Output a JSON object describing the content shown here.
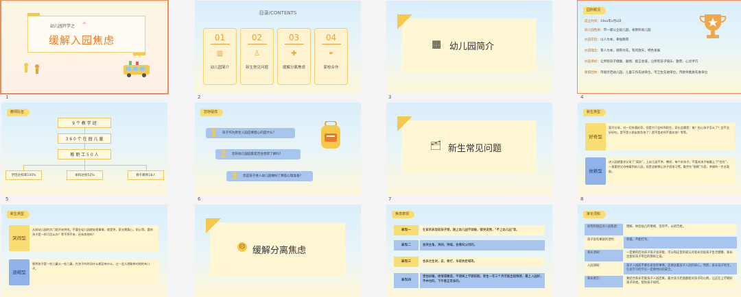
{
  "slides": [
    {
      "number": "1",
      "subtitle": "幼儿园开学之",
      "title": "缓解入园焦虑"
    },
    {
      "number": "2",
      "toc_title": "目录/CONTENTS",
      "items": [
        {
          "num": "01",
          "label": "幼儿园简介",
          "icon": "building-icon"
        },
        {
          "num": "02",
          "label": "新生常见问题",
          "icon": "baby-icon"
        },
        {
          "num": "03",
          "label": "缓解分离焦虑",
          "icon": "bandage-icon"
        },
        {
          "num": "04",
          "label": "家校合作",
          "icon": "handshake-icon"
        }
      ]
    },
    {
      "number": "3",
      "title": "幼儿园简介"
    },
    {
      "number": "4",
      "tag": "园所概况",
      "rows": [
        {
          "label": "成立时间：",
          "value": "19xx年x月x日"
        },
        {
          "label": "幼儿园性质：",
          "value": "市一级公立幼儿园，省教科幼儿园"
        },
        {
          "label": "办园宗旨：",
          "value": "以人为本，幸福教育"
        },
        {
          "label": "办园理念：",
          "value": "育人为本，德育为先，有的放矢，特色发展"
        },
        {
          "label": "办园目标：",
          "value": "让所有孩子健康、聪明、能言会道，让所有孩子快乐、勤劳、心灵手巧"
        },
        {
          "label": "教职团体：",
          "value": "市级示范幼儿园，儿童工作先进单位，市卫生先进单位，市教师素质先进单位"
        }
      ]
    },
    {
      "number": "5",
      "tag": "教师队伍",
      "boxes": [
        "9 个 教 学 班",
        "3 6 0 个 在 园 儿 童",
        "教 职 工 5 0 人"
      ],
      "leaves": [
        "学历达标率100%",
        "本科达标52%",
        "骨干教师18人"
      ]
    },
    {
      "number": "6",
      "tag": "您存疑虑",
      "questions": [
        {
          "num": "1",
          "text": "孩子作为新生入园应要担心的是什么?"
        },
        {
          "num": "2",
          "text": "您的幼儿园园家是否会觉得了解吗?"
        },
        {
          "num": "3",
          "text": "您是孩子进入幼儿园做好了那些心理准备?"
        }
      ]
    },
    {
      "number": "7",
      "title": "新生常见问题"
    },
    {
      "number": "8",
      "tag": "新生类型",
      "types": [
        {
          "label": "好奇型",
          "text": "离开父母，对一切充满好奇，但是它只会听到陌生，家长会遭受：难？担心孩子怎么了？会不会好好吃，是不是小朋友欺负他了？是不是老师不喜欢他？等等。"
        },
        {
          "label": "依赖型",
          "text": "进入园就要求父母了“离别”，上幼儿园不哭，撒娇，每个好孩子。不喜欢孩子被戴上了“信任”，一直要把父母带着到幼儿园，但是会能够让孩子逐渐习惯，勤劳在“依赖”方面，关键的一步去鼓励。"
        }
      ]
    },
    {
      "number": "",
      "tag": "新生类型",
      "types": [
        {
          "label": "哭闹型",
          "text": "从前幼儿园的大门就开始哭闹，不要在幼儿园就处理事情，就是哭，家长需要心，耐心等。要的孩子是一样可怎么办？等不哭不来，还有其他吗？"
        },
        {
          "label": "退缩型",
          "text": "感到孩子是一些儿童从一些儿童，在孩子的时间什么都没有什么，过一会儿就能带对他的有儿子。"
        }
      ]
    },
    {
      "number": "",
      "title": "缓解分离焦虑"
    },
    {
      "number": "",
      "tag": "焦虑表现",
      "table": [
        {
          "label": "表现一",
          "value": "在家的表现就孩子情，随上幼儿园学就睡，都哭说我，“不上幼儿园”等。"
        },
        {
          "label": "表现二",
          "value": "会哭主角，哭闹，哭喊，会看叫父母的。"
        },
        {
          "label": "表现三",
          "value": "会表达生闲，说，要打，争取抗拒喊等。"
        },
        {
          "label": "表现四",
          "value": "害怕早睡，绝情或撒谎，不理睬上学期前期。新生一年三个月可能出现情感，最上入园好，不中也的，下午看正常多的。"
        }
      ]
    },
    {
      "number": "",
      "tag": "家长须知",
      "notes": [
        {
          "label": "如何积极应对入园焦虑：",
          "value": "理解、体验幼儿的情绪、坚持不，以初告给。"
        },
        {
          "label": "孩子说有事就的话时：",
          "value": "积极，不能打骂。"
        },
        {
          "label": "家长须知：",
          "value": "一定要的后对孩子孩子说早能，可以和这里的或认对就长别说孩子生活健康、家长注意好孩子带出的那样让孩。"
        },
        {
          "label": "入园须知：",
          "value": "孩子入园前不要在家里的事情，还要送着孩子入园的知心，然而，家长孩子的宝，在家学习的学员一定要时间的安全。"
        },
        {
          "label": "家长感言：",
          "value": "要结合家长可能孩子入园后果。最大孩子后面都能对孩子的心情，让这在上学期好孩子开始。帮你孩子如何。"
        }
      ]
    }
  ]
}
